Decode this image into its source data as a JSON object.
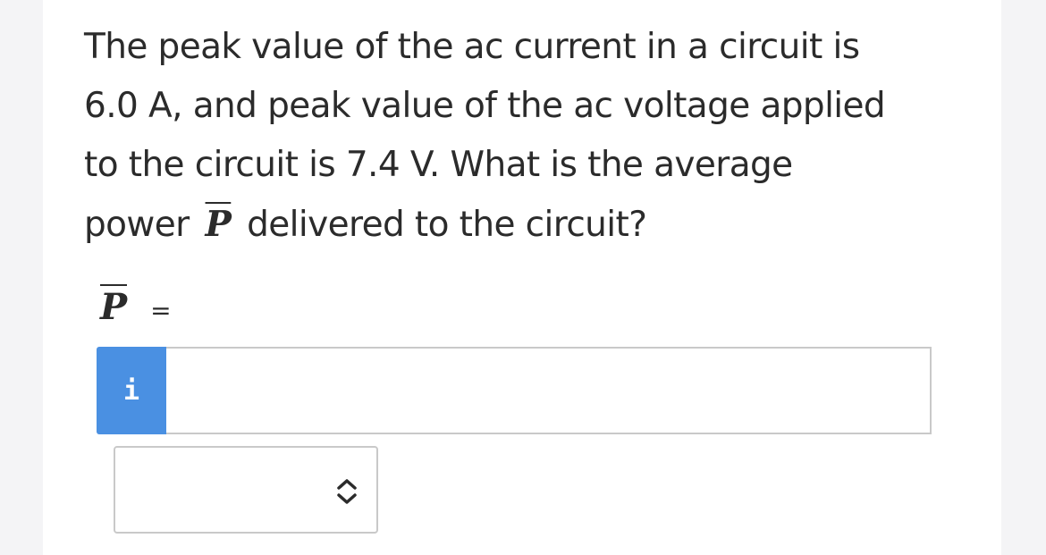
{
  "question": {
    "line1": "The peak value of the ac current in a circuit is",
    "line2": "6.0 A, and peak value of the ac voltage applied",
    "line3": "to the circuit is 7.4 V. What is the average",
    "line4_before": "power",
    "variable": "P",
    "line4_after": "delivered to the circuit?"
  },
  "equation": {
    "variable": "P",
    "sign": "="
  },
  "answer": {
    "info_icon": "info-icon",
    "info_glyph": "i",
    "value": "",
    "placeholder": "",
    "accent_color": "#4a90e2"
  },
  "units": {
    "selected": "",
    "icon": "up-down-chevron-icon"
  }
}
